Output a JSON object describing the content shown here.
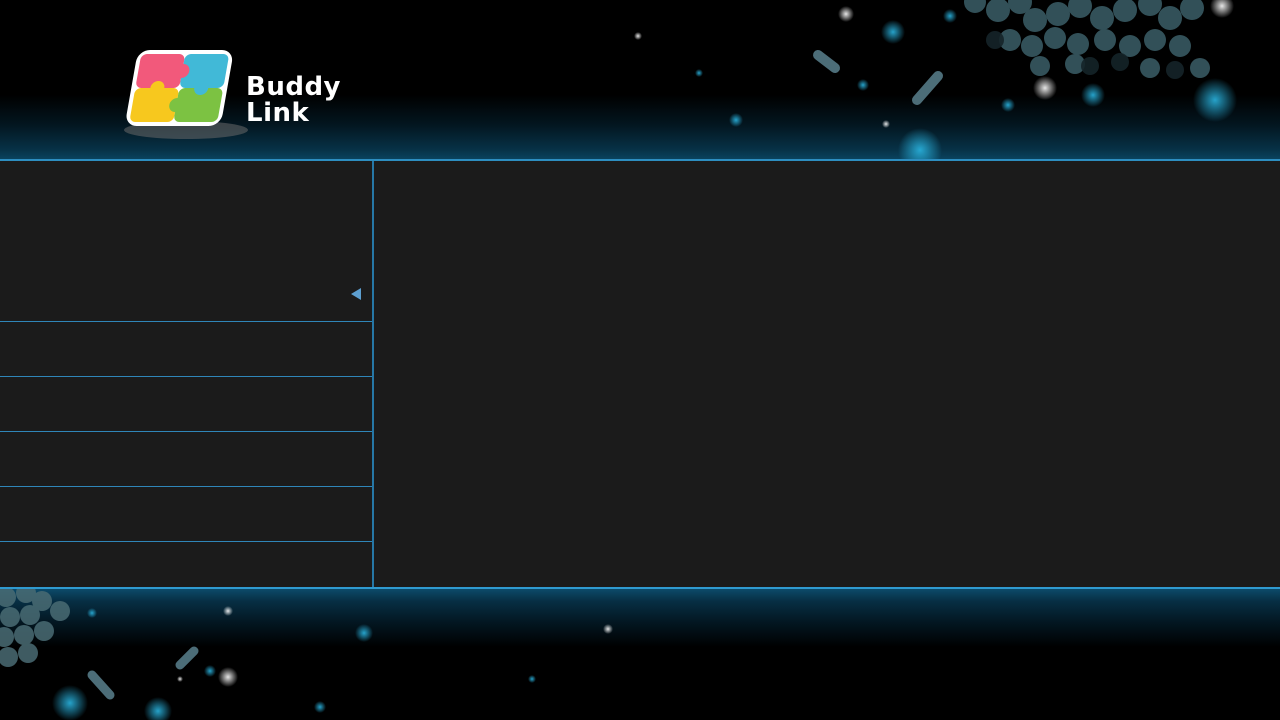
{
  "app": {
    "logo_line1": "Buddy",
    "logo_line2": "Link"
  },
  "colors": {
    "accent": "#2d8ec0",
    "panel_bg": "#1b1b1b",
    "header_bg": "#000000",
    "arrow": "#5d9fd0"
  },
  "sidebar": {
    "items": [
      {
        "label": ""
      },
      {
        "label": ""
      },
      {
        "label": ""
      },
      {
        "label": ""
      },
      {
        "label": ""
      },
      {
        "label": ""
      }
    ],
    "collapse_icon": "triangle-left-icon"
  }
}
